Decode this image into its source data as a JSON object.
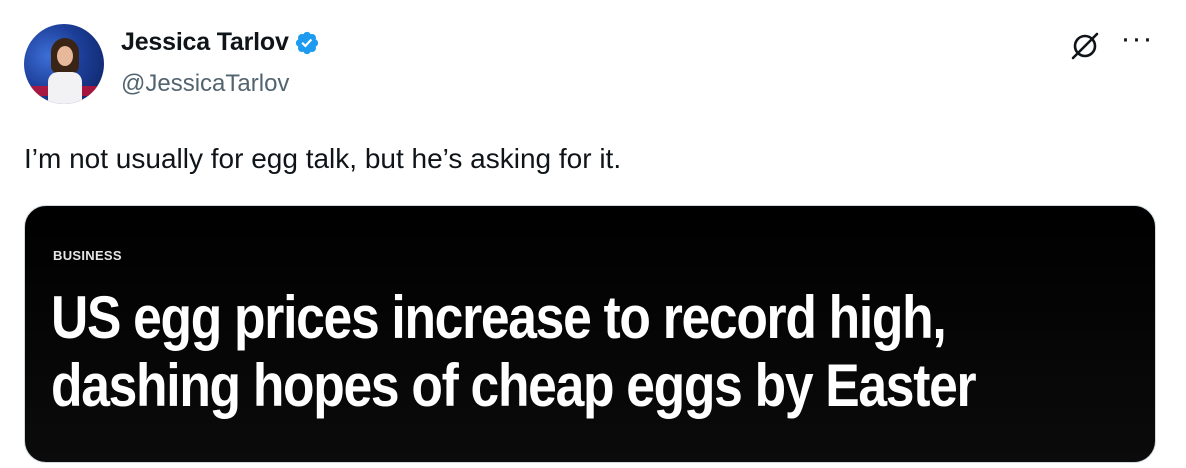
{
  "author": {
    "display_name": "Jessica Tarlov",
    "handle": "@JessicaTarlov",
    "verified": true,
    "verified_color": "#1d9bf0"
  },
  "tweet": {
    "text": "I’m not usually for egg talk, but he’s asking for it."
  },
  "media": {
    "kicker": "BUSINESS",
    "headline_line1": "US egg prices increase to record high,",
    "headline_line2": "dashing hopes of cheap eggs by Easter"
  },
  "icons": {
    "grok": "grok-icon",
    "more": "more-icon",
    "more_glyph": "···"
  }
}
